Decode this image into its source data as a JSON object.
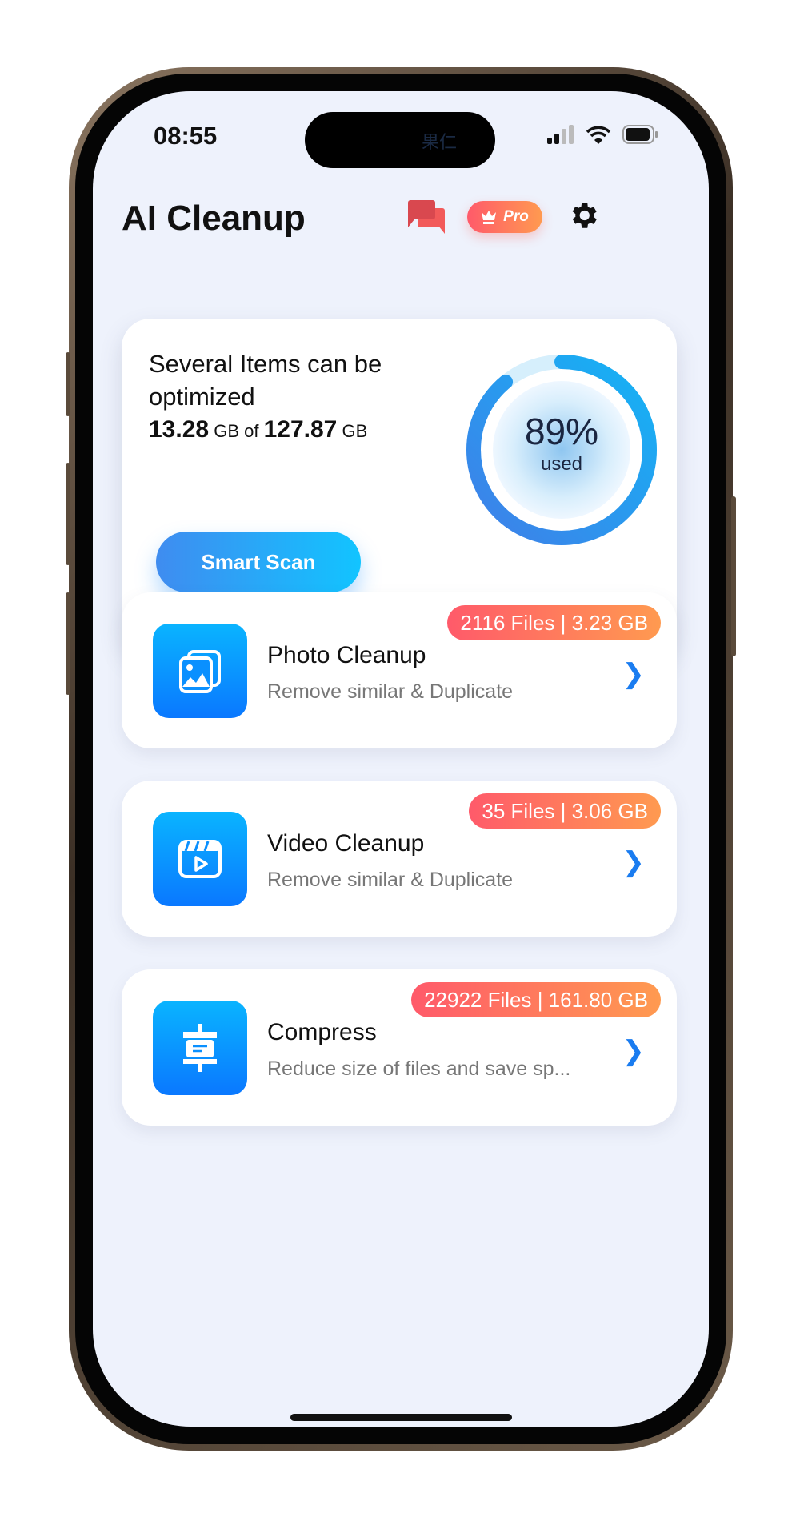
{
  "status_bar": {
    "time": "08:55",
    "island_overlay": "果仁"
  },
  "header": {
    "title": "AI Cleanup",
    "pro_label": "Pro"
  },
  "storage_card": {
    "title": "Several Items can be optimized",
    "used_value": "13.28",
    "used_unit": "GB",
    "of": "of",
    "total_value": "127.87",
    "total_unit": "GB",
    "percent": "89%",
    "percent_value": 89,
    "used_label": "used",
    "scan_button": "Smart Scan"
  },
  "items": [
    {
      "title": "Photo Cleanup",
      "subtitle": "Remove similar & Duplicate",
      "badge": "2116 Files | 3.23 GB",
      "icon": "photos-icon"
    },
    {
      "title": "Video Cleanup",
      "subtitle": "Remove similar & Duplicate",
      "badge": "35 Files | 3.06 GB",
      "icon": "video-icon"
    },
    {
      "title": "Compress",
      "subtitle": "Reduce size of files and save sp...",
      "badge": "22922 Files | 161.80 GB",
      "icon": "compress-icon"
    }
  ],
  "colors": {
    "accent": "#1a7cf0",
    "badge_start": "#ff5a6a",
    "badge_end": "#ff9a50",
    "background": "#eef2fc"
  }
}
